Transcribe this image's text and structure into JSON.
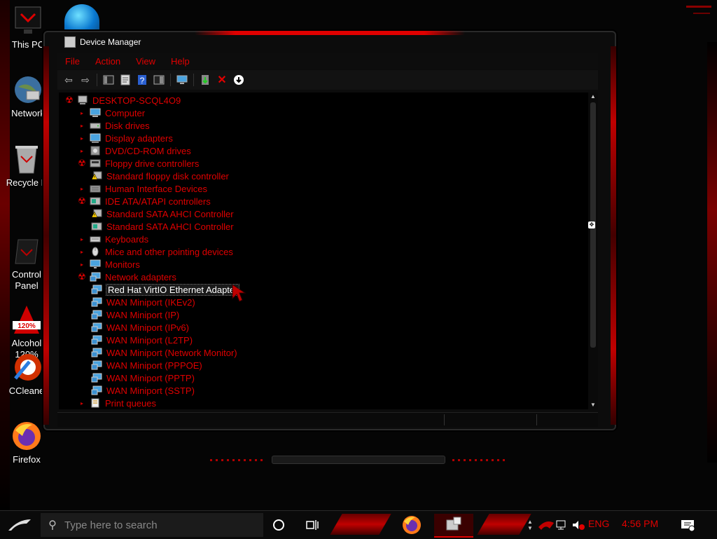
{
  "desktop": {
    "icons": [
      {
        "label": "This PC",
        "icon": "computer-icon"
      },
      {
        "label": "Network",
        "icon": "network-globe-icon"
      },
      {
        "label": "Recycle B",
        "icon": "recycle-bin-icon"
      },
      {
        "label": "Control\nPanel",
        "icon": "control-panel-icon"
      },
      {
        "label": "Alcohol\n120%",
        "icon": "alcohol-120-icon"
      },
      {
        "label": "CCleane",
        "icon": "ccleaner-icon"
      },
      {
        "label": "Firefox",
        "icon": "firefox-icon"
      }
    ]
  },
  "window": {
    "title": "Device Manager",
    "menu": [
      "File",
      "Action",
      "View",
      "Help"
    ],
    "toolbar_icons": [
      "back-arrow-icon",
      "forward-arrow-icon",
      "show-hide-console-tree-icon",
      "properties-icon",
      "help-icon",
      "action-pane-icon",
      "monitor-icon",
      "update-driver-icon",
      "uninstall-device-icon",
      "disable-device-icon"
    ],
    "tree": {
      "root": "DESKTOP-SCQL4O9",
      "nodes": [
        {
          "label": "Computer",
          "level": 1,
          "state": "collapsed",
          "icon": "computer-icon"
        },
        {
          "label": "Disk drives",
          "level": 1,
          "state": "collapsed",
          "icon": "disk-drive-icon"
        },
        {
          "label": "Display adapters",
          "level": 1,
          "state": "collapsed",
          "icon": "display-adapter-icon"
        },
        {
          "label": "DVD/CD-ROM drives",
          "level": 1,
          "state": "collapsed",
          "icon": "dvd-drive-icon"
        },
        {
          "label": "Floppy drive controllers",
          "level": 1,
          "state": "expanded",
          "icon": "floppy-controller-icon"
        },
        {
          "label": "Standard floppy disk controller",
          "level": 2,
          "state": "leaf",
          "icon": "warning-device-icon"
        },
        {
          "label": "Human Interface Devices",
          "level": 1,
          "state": "collapsed",
          "icon": "hid-icon"
        },
        {
          "label": "IDE ATA/ATAPI controllers",
          "level": 1,
          "state": "expanded",
          "icon": "ide-controller-icon"
        },
        {
          "label": "Standard SATA AHCI Controller",
          "level": 2,
          "state": "leaf",
          "icon": "warning-device-icon"
        },
        {
          "label": "Standard SATA AHCI Controller",
          "level": 2,
          "state": "leaf",
          "icon": "ide-controller-icon"
        },
        {
          "label": "Keyboards",
          "level": 1,
          "state": "collapsed",
          "icon": "keyboard-icon"
        },
        {
          "label": "Mice and other pointing devices",
          "level": 1,
          "state": "collapsed",
          "icon": "mouse-icon"
        },
        {
          "label": "Monitors",
          "level": 1,
          "state": "collapsed",
          "icon": "monitor-icon"
        },
        {
          "label": "Network adapters",
          "level": 1,
          "state": "expanded",
          "icon": "network-adapter-icon"
        },
        {
          "label": "Red Hat VirtIO Ethernet Adapter",
          "level": 2,
          "state": "leaf",
          "icon": "network-adapter-icon",
          "selected": true
        },
        {
          "label": "WAN Miniport (IKEv2)",
          "level": 2,
          "state": "leaf",
          "icon": "network-adapter-icon"
        },
        {
          "label": "WAN Miniport (IP)",
          "level": 2,
          "state": "leaf",
          "icon": "network-adapter-icon"
        },
        {
          "label": "WAN Miniport (IPv6)",
          "level": 2,
          "state": "leaf",
          "icon": "network-adapter-icon"
        },
        {
          "label": "WAN Miniport (L2TP)",
          "level": 2,
          "state": "leaf",
          "icon": "network-adapter-icon"
        },
        {
          "label": "WAN Miniport (Network Monitor)",
          "level": 2,
          "state": "leaf",
          "icon": "network-adapter-icon"
        },
        {
          "label": "WAN Miniport (PPPOE)",
          "level": 2,
          "state": "leaf",
          "icon": "network-adapter-icon"
        },
        {
          "label": "WAN Miniport (PPTP)",
          "level": 2,
          "state": "leaf",
          "icon": "network-adapter-icon"
        },
        {
          "label": "WAN Miniport (SSTP)",
          "level": 2,
          "state": "leaf",
          "icon": "network-adapter-icon"
        },
        {
          "label": "Print queues",
          "level": 1,
          "state": "collapsed",
          "icon": "print-queue-icon"
        }
      ]
    }
  },
  "taskbar": {
    "search_placeholder": "Type here to search",
    "language": "ENG",
    "time": "4:56 PM",
    "pinned": [
      "firefox-icon",
      "device-manager-icon"
    ]
  },
  "colors": {
    "accent": "#e00000",
    "background": "#050505",
    "selected_text": "#ffffff"
  }
}
